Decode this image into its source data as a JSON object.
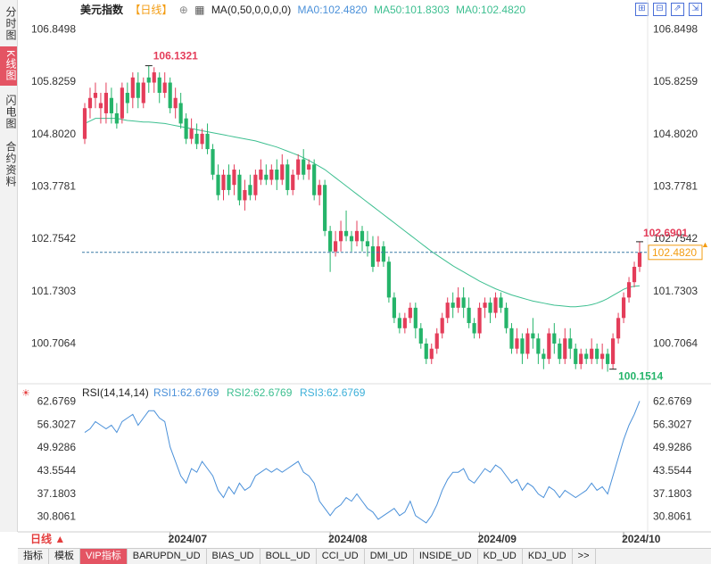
{
  "sidebar": {
    "items": [
      {
        "label": "分时图",
        "active": false
      },
      {
        "label": "K线图",
        "active": true
      },
      {
        "label": "闪电图",
        "active": false
      },
      {
        "label": "合约资料",
        "active": false
      }
    ]
  },
  "header": {
    "title": "美元指数",
    "period": "【日线】",
    "ma_params": "MA(0,50,0,0,0,0)",
    "ma0_label": "MA0:102.4820",
    "ma50_label": "MA50:101.8303",
    "ma0b_label": "MA0:102.4820"
  },
  "window_buttons": [
    "⊞",
    "⊟",
    "⇗",
    "⇲"
  ],
  "period_button": {
    "label": "日线"
  },
  "bottom_tabs": [
    {
      "label": "指标",
      "active": false
    },
    {
      "label": "模板",
      "active": false
    },
    {
      "label": "VIP指标",
      "active": true
    },
    {
      "label": "BARUPDN_UD",
      "active": false
    },
    {
      "label": "BIAS_UD",
      "active": false
    },
    {
      "label": "BOLL_UD",
      "active": false
    },
    {
      "label": "CCI_UD",
      "active": false
    },
    {
      "label": "DMI_UD",
      "active": false
    },
    {
      "label": "INSIDE_UD",
      "active": false
    },
    {
      "label": "KD_UD",
      "active": false
    },
    {
      "label": "KDJ_UD",
      "active": false
    },
    {
      "label": ">>",
      "active": false
    }
  ],
  "colors": {
    "up": "#e43d5a",
    "down": "#25b46a",
    "ma": "#3dbf90",
    "rsi": "#4a90d9",
    "hl_high": "#e43d5a",
    "hl_low": "#25b46a",
    "last": "#f39c12"
  },
  "chart_data": [
    {
      "type": "candlestick",
      "title": "美元指数",
      "y_ticks": [
        "106.8498",
        "105.8259",
        "104.8020",
        "103.7781",
        "102.7542",
        "101.7303",
        "100.7064"
      ],
      "ylim": [
        99.95,
        107.1
      ],
      "x_ticks": [
        "2024/07",
        "2024/08",
        "2024/09",
        "2024/10"
      ],
      "x_tick_index": [
        16,
        46,
        74,
        101
      ],
      "high_label": "106.1321",
      "high_index": 12,
      "low_label": "100.1514",
      "low_index": 99,
      "last_high_label": "102.6901",
      "last_high_index": 104,
      "last_price_label": "102.4820",
      "last_price": 102.482,
      "candles": [
        [
          104.7,
          105.3,
          104.6,
          105.4
        ],
        [
          105.3,
          105.5,
          105.1,
          105.7
        ],
        [
          105.5,
          105.6,
          105.3,
          105.8
        ],
        [
          105.3,
          105.4,
          105.0,
          105.6
        ],
        [
          105.2,
          105.6,
          105.0,
          105.8
        ],
        [
          105.5,
          105.2,
          105.0,
          105.7
        ],
        [
          105.2,
          105.0,
          104.9,
          105.4
        ],
        [
          105.1,
          105.7,
          105.0,
          105.8
        ],
        [
          105.6,
          105.4,
          105.2,
          105.8
        ],
        [
          105.5,
          105.9,
          105.3,
          106.0
        ],
        [
          105.8,
          105.5,
          105.3,
          106.0
        ],
        [
          105.4,
          105.8,
          105.3,
          105.9
        ],
        [
          105.9,
          105.8,
          105.6,
          106.13
        ],
        [
          105.8,
          106.0,
          105.6,
          106.1
        ],
        [
          105.9,
          105.6,
          105.4,
          106.0
        ],
        [
          105.6,
          105.8,
          105.5,
          106.0
        ],
        [
          105.8,
          105.3,
          105.2,
          105.9
        ],
        [
          105.3,
          105.5,
          105.1,
          105.7
        ],
        [
          105.4,
          105.0,
          104.9,
          105.6
        ],
        [
          105.1,
          104.7,
          104.6,
          105.2
        ],
        [
          104.7,
          104.9,
          104.6,
          105.1
        ],
        [
          104.8,
          104.6,
          104.5,
          105.0
        ],
        [
          104.6,
          104.8,
          104.5,
          104.9
        ],
        [
          104.8,
          104.5,
          104.4,
          105.0
        ],
        [
          104.5,
          104.0,
          103.9,
          104.6
        ],
        [
          104.0,
          103.6,
          103.5,
          104.2
        ],
        [
          103.7,
          104.0,
          103.5,
          104.1
        ],
        [
          104.0,
          103.7,
          103.6,
          104.2
        ],
        [
          103.8,
          104.1,
          103.6,
          104.2
        ],
        [
          104.0,
          103.5,
          103.4,
          104.1
        ],
        [
          103.5,
          103.7,
          103.3,
          103.9
        ],
        [
          103.8,
          103.6,
          103.5,
          104.0
        ],
        [
          103.6,
          104.0,
          103.5,
          104.1
        ],
        [
          103.9,
          104.1,
          103.8,
          104.3
        ],
        [
          104.0,
          103.9,
          103.8,
          104.2
        ],
        [
          103.9,
          104.1,
          103.8,
          104.2
        ],
        [
          104.1,
          103.9,
          103.7,
          104.3
        ],
        [
          103.9,
          104.2,
          103.8,
          104.4
        ],
        [
          104.2,
          103.7,
          103.6,
          104.3
        ],
        [
          103.7,
          104.0,
          103.6,
          104.1
        ],
        [
          104.0,
          104.3,
          103.9,
          104.4
        ],
        [
          104.3,
          104.0,
          103.9,
          104.5
        ],
        [
          104.1,
          104.2,
          103.9,
          104.3
        ],
        [
          104.2,
          103.6,
          103.5,
          104.3
        ],
        [
          103.6,
          103.8,
          103.4,
          103.9
        ],
        [
          103.8,
          102.9,
          102.8,
          103.9
        ],
        [
          102.9,
          102.5,
          102.1,
          103.0
        ],
        [
          102.5,
          102.7,
          102.4,
          102.9
        ],
        [
          102.7,
          102.9,
          102.5,
          103.1
        ],
        [
          102.9,
          102.8,
          102.7,
          103.3
        ],
        [
          102.8,
          102.7,
          102.5,
          102.9
        ],
        [
          102.7,
          102.9,
          102.6,
          103.1
        ],
        [
          102.9,
          102.7,
          102.5,
          103.0
        ],
        [
          102.7,
          102.6,
          102.4,
          102.9
        ],
        [
          102.6,
          102.2,
          102.1,
          102.8
        ],
        [
          102.3,
          102.6,
          102.2,
          102.8
        ],
        [
          102.6,
          102.3,
          102.2,
          102.7
        ],
        [
          102.3,
          101.6,
          101.5,
          102.4
        ],
        [
          101.6,
          101.2,
          101.1,
          101.7
        ],
        [
          101.2,
          101.0,
          100.9,
          101.3
        ],
        [
          101.0,
          101.2,
          100.9,
          101.3
        ],
        [
          101.2,
          101.4,
          101.1,
          101.5
        ],
        [
          101.4,
          101.0,
          100.8,
          101.5
        ],
        [
          101.0,
          100.7,
          100.6,
          101.1
        ],
        [
          100.7,
          100.4,
          100.3,
          100.8
        ],
        [
          100.4,
          100.6,
          100.3,
          100.7
        ],
        [
          100.6,
          100.9,
          100.5,
          101.0
        ],
        [
          100.9,
          101.2,
          100.8,
          101.3
        ],
        [
          101.2,
          101.5,
          101.1,
          101.6
        ],
        [
          101.5,
          101.4,
          101.2,
          101.7
        ],
        [
          101.4,
          101.6,
          101.3,
          101.8
        ],
        [
          101.6,
          101.4,
          101.2,
          101.8
        ],
        [
          101.4,
          101.1,
          101.0,
          101.6
        ],
        [
          101.1,
          100.9,
          100.8,
          101.2
        ],
        [
          100.9,
          101.4,
          100.8,
          101.5
        ],
        [
          101.4,
          101.5,
          101.2,
          101.6
        ],
        [
          101.5,
          101.3,
          101.1,
          101.6
        ],
        [
          101.3,
          101.6,
          101.2,
          101.7
        ],
        [
          101.6,
          101.4,
          101.3,
          101.7
        ],
        [
          101.4,
          101.0,
          100.9,
          101.5
        ],
        [
          101.0,
          100.6,
          100.5,
          101.1
        ],
        [
          100.6,
          100.8,
          100.5,
          101.0
        ],
        [
          100.8,
          100.5,
          100.3,
          100.9
        ],
        [
          100.5,
          100.9,
          100.4,
          101.0
        ],
        [
          100.9,
          100.8,
          100.6,
          101.2
        ],
        [
          100.8,
          100.5,
          100.3,
          100.9
        ],
        [
          100.5,
          100.4,
          100.2,
          100.6
        ],
        [
          100.4,
          100.9,
          100.3,
          101.0
        ],
        [
          100.9,
          100.7,
          100.5,
          101.1
        ],
        [
          100.7,
          100.4,
          100.3,
          100.8
        ],
        [
          100.4,
          100.8,
          100.3,
          101.0
        ],
        [
          100.8,
          100.6,
          100.4,
          101.0
        ],
        [
          100.6,
          100.3,
          100.2,
          100.7
        ],
        [
          100.3,
          100.5,
          100.2,
          100.6
        ],
        [
          100.5,
          100.4,
          100.3,
          100.6
        ],
        [
          100.4,
          100.6,
          100.3,
          100.8
        ],
        [
          100.6,
          100.4,
          100.3,
          100.7
        ],
        [
          100.4,
          100.5,
          100.2,
          100.7
        ],
        [
          100.5,
          100.3,
          100.15,
          100.6
        ],
        [
          100.3,
          100.8,
          100.2,
          100.9
        ],
        [
          100.8,
          101.2,
          100.7,
          101.3
        ],
        [
          101.2,
          101.6,
          101.1,
          101.7
        ],
        [
          101.6,
          101.9,
          101.5,
          102.0
        ],
        [
          101.9,
          102.2,
          101.8,
          102.3
        ],
        [
          102.2,
          102.48,
          102.1,
          102.69
        ]
      ],
      "ma50": [
        105.0,
        105.05,
        105.1,
        105.1,
        105.1,
        105.1,
        105.1,
        105.08,
        105.06,
        105.05,
        105.04,
        105.03,
        105.03,
        105.02,
        105.01,
        105.0,
        104.98,
        104.96,
        104.94,
        104.92,
        104.9,
        104.88,
        104.86,
        104.84,
        104.82,
        104.8,
        104.78,
        104.76,
        104.74,
        104.72,
        104.7,
        104.68,
        104.66,
        104.63,
        104.6,
        104.57,
        104.54,
        104.5,
        104.46,
        104.42,
        104.38,
        104.33,
        104.28,
        104.22,
        104.16,
        104.1,
        104.02,
        103.94,
        103.86,
        103.78,
        103.7,
        103.62,
        103.54,
        103.46,
        103.38,
        103.3,
        103.22,
        103.14,
        103.06,
        102.98,
        102.9,
        102.82,
        102.74,
        102.66,
        102.58,
        102.5,
        102.43,
        102.36,
        102.29,
        102.22,
        102.16,
        102.1,
        102.04,
        101.98,
        101.92,
        101.87,
        101.82,
        101.77,
        101.73,
        101.69,
        101.65,
        101.62,
        101.59,
        101.56,
        101.53,
        101.51,
        101.49,
        101.47,
        101.45,
        101.44,
        101.43,
        101.42,
        101.42,
        101.43,
        101.44,
        101.46,
        101.49,
        101.53,
        101.58,
        101.64,
        101.7,
        101.76,
        101.8,
        101.82,
        101.83
      ]
    },
    {
      "type": "line",
      "title": "RSI(14,14,14)",
      "series_labels": [
        "RSI1:62.6769",
        "RSI2:62.6769",
        "RSI3:62.6769"
      ],
      "y_ticks": [
        "62.6769",
        "56.3027",
        "49.9286",
        "43.5544",
        "37.1803",
        "30.8061"
      ],
      "ylim": [
        28.0,
        65.0
      ],
      "series": [
        {
          "name": "RSI1",
          "values": [
            54,
            55,
            57,
            56,
            55,
            56,
            54,
            57,
            58,
            59,
            56,
            58,
            60,
            60,
            58,
            57,
            50,
            46,
            42,
            40,
            44,
            43,
            46,
            44,
            42,
            38,
            36,
            39,
            37,
            40,
            38,
            39,
            42,
            43,
            44,
            43,
            44,
            43,
            44,
            45,
            46,
            43,
            42,
            40,
            35,
            33,
            31,
            33,
            34,
            36,
            35,
            37,
            35,
            33,
            32,
            30,
            31,
            32,
            33,
            31,
            32,
            35,
            31,
            30,
            29,
            31,
            34,
            38,
            41,
            43,
            43,
            44,
            41,
            40,
            42,
            44,
            43,
            45,
            44,
            42,
            40,
            41,
            38,
            40,
            39,
            37,
            36,
            39,
            38,
            36,
            38,
            37,
            36,
            37,
            38,
            40,
            38,
            39,
            37,
            42,
            47,
            52,
            56,
            59,
            62.68
          ]
        }
      ]
    }
  ]
}
